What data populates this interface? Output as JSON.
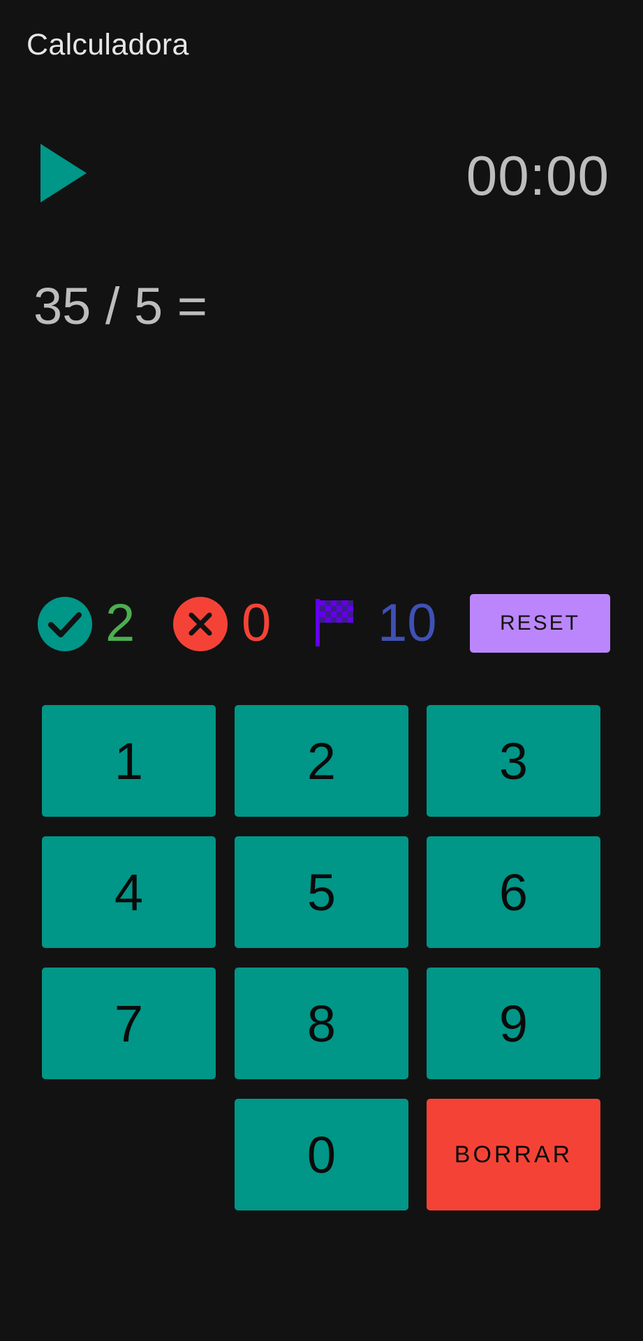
{
  "app": {
    "title": "Calculadora"
  },
  "timer": {
    "value": "00:00"
  },
  "question": {
    "text": "35 / 5 ="
  },
  "stats": {
    "correct": "2",
    "wrong": "0",
    "total": "10",
    "reset_label": "RESET"
  },
  "keypad": {
    "k1": "1",
    "k2": "2",
    "k3": "3",
    "k4": "4",
    "k5": "5",
    "k6": "6",
    "k7": "7",
    "k8": "8",
    "k9": "9",
    "k0": "0",
    "delete_label": "BORRAR"
  },
  "icons": {
    "play": "play-icon",
    "correct": "check-circle-icon",
    "wrong": "close-circle-icon",
    "total": "checkered-flag-icon"
  },
  "colors": {
    "background": "#121212",
    "teal": "#009688",
    "correct_text": "#4caf50",
    "wrong": "#f44336",
    "flag": "#6200ea",
    "total_text": "#3f51b5",
    "reset_bg": "#bb86fc",
    "delete_bg": "#f44336"
  }
}
